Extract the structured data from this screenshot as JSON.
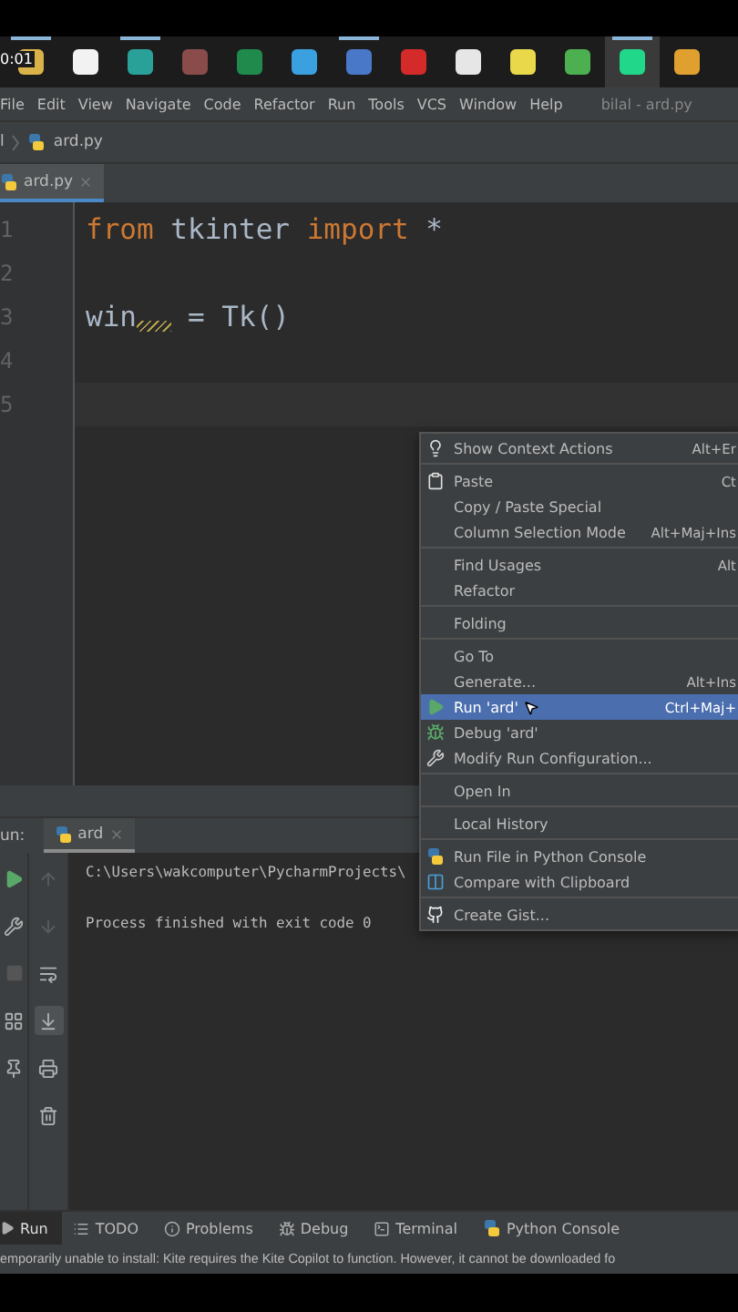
{
  "taskbar": {
    "clock": "0:01",
    "apps": [
      {
        "color": "#d9b24a",
        "running": true,
        "selected": false
      },
      {
        "color": "#f2f2f2",
        "running": false,
        "selected": false
      },
      {
        "color": "#2aa198",
        "running": true,
        "selected": false
      },
      {
        "color": "#8a4b4b",
        "running": false,
        "selected": false
      },
      {
        "color": "#1f8a4c",
        "running": false,
        "selected": false
      },
      {
        "color": "#3aa0e0",
        "running": false,
        "selected": false
      },
      {
        "color": "#4a78c8",
        "running": true,
        "selected": false
      },
      {
        "color": "#d42a2a",
        "running": false,
        "selected": false
      },
      {
        "color": "#e6e6e6",
        "running": false,
        "selected": false
      },
      {
        "color": "#e8d84a",
        "running": false,
        "selected": false
      },
      {
        "color": "#4caf50",
        "running": false,
        "selected": false
      },
      {
        "color": "#21d789",
        "running": true,
        "selected": true
      },
      {
        "color": "#e0a030",
        "running": false,
        "selected": false
      }
    ]
  },
  "menubar": {
    "items": [
      "File",
      "Edit",
      "View",
      "Navigate",
      "Code",
      "Refactor",
      "Run",
      "Tools",
      "VCS",
      "Window",
      "Help"
    ],
    "title": "bilal - ard.py"
  },
  "breadcrumb": {
    "parent": "l",
    "file": "ard.py"
  },
  "tabs": [
    {
      "label": "ard.py",
      "selected": true
    }
  ],
  "editor": {
    "lines": [
      {
        "number": "1",
        "tokens": [
          {
            "text": "from",
            "kind": "keyword"
          },
          {
            "text": " tkinter ",
            "kind": "plain"
          },
          {
            "text": "import",
            "kind": "keyword"
          },
          {
            "text": " *",
            "kind": "plain"
          }
        ]
      },
      {
        "number": "2"
      },
      {
        "number": "3",
        "tokens": [
          {
            "text": "win",
            "kind": "plain",
            "warning": true
          },
          {
            "text": " = Tk()",
            "kind": "plain"
          }
        ]
      },
      {
        "number": "4"
      },
      {
        "number": "5",
        "current": true
      }
    ]
  },
  "context_menu": {
    "items": [
      {
        "kind": "item",
        "label": "Show Context Actions",
        "shortcut": "Alt+Er",
        "selected": false
      },
      {
        "kind": "separator"
      },
      {
        "kind": "item",
        "label": "Paste",
        "shortcut": "Ct",
        "selected": false
      },
      {
        "kind": "item",
        "label": "Copy / Paste Special",
        "selected": false
      },
      {
        "kind": "item",
        "label": "Column Selection Mode",
        "shortcut": "Alt+Maj+Ins",
        "selected": false
      },
      {
        "kind": "separator"
      },
      {
        "kind": "item",
        "label": "Find Usages",
        "shortcut": "Alt",
        "selected": false
      },
      {
        "kind": "item",
        "label": "Refactor",
        "selected": false
      },
      {
        "kind": "separator"
      },
      {
        "kind": "item",
        "label": "Folding",
        "selected": false
      },
      {
        "kind": "separator"
      },
      {
        "kind": "item",
        "label": "Go To",
        "selected": false
      },
      {
        "kind": "item",
        "label": "Generate...",
        "shortcut": "Alt+Ins",
        "selected": false
      },
      {
        "kind": "item",
        "label": "Run 'ard'",
        "shortcut": "Ctrl+Maj+",
        "selected": true
      },
      {
        "kind": "item",
        "label": "Debug 'ard'",
        "selected": false
      },
      {
        "kind": "item",
        "label": "Modify Run Configuration...",
        "selected": false
      },
      {
        "kind": "separator"
      },
      {
        "kind": "item",
        "label": "Open In",
        "selected": false
      },
      {
        "kind": "separator"
      },
      {
        "kind": "item",
        "label": "Local History",
        "selected": false
      },
      {
        "kind": "separator"
      },
      {
        "kind": "item",
        "label": "Run File in Python Console",
        "selected": false
      },
      {
        "kind": "item",
        "label": "Compare with Clipboard",
        "selected": false
      },
      {
        "kind": "separator"
      },
      {
        "kind": "item",
        "label": "Create Gist...",
        "selected": false
      }
    ]
  },
  "run_panel": {
    "label": "un:",
    "tabs": [
      {
        "label": "ard",
        "selected": true
      }
    ],
    "console": [
      "C:\\Users\\wakcomputer\\PycharmProjects\\",
      "Process finished with exit code 0"
    ]
  },
  "tool_windows": [
    {
      "label": "Run",
      "selected": true
    },
    {
      "label": "TODO",
      "selected": false
    },
    {
      "label": "Problems",
      "selected": false
    },
    {
      "label": "Debug",
      "selected": false
    },
    {
      "label": "Terminal",
      "selected": false
    },
    {
      "label": "Python Console",
      "selected": false
    }
  ],
  "status_bar": {
    "message": "emporarily unable to install: Kite requires the Kite Copilot to function. However, it cannot be downloaded fo"
  }
}
